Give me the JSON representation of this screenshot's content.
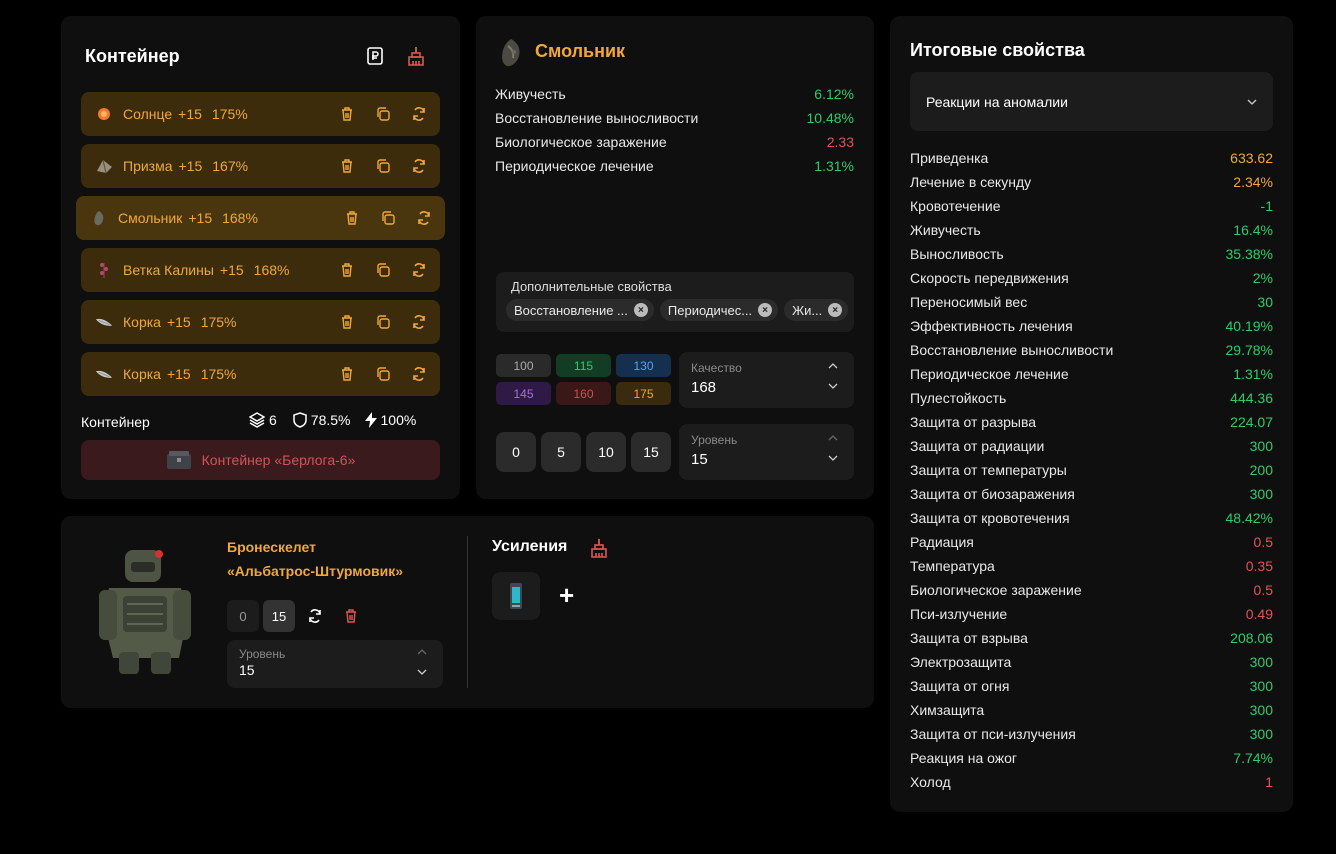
{
  "container": {
    "title": "Контейнер",
    "artifacts": [
      {
        "name": "Солнце",
        "plus": "+15",
        "percent": "175%",
        "icon": "sun-artifact-icon"
      },
      {
        "name": "Призма",
        "plus": "+15",
        "percent": "167%",
        "icon": "prism-artifact-icon"
      },
      {
        "name": "Смольник",
        "plus": "+15",
        "percent": "168%",
        "icon": "smolnik-artifact-icon"
      },
      {
        "name": "Ветка Калины",
        "plus": "+15",
        "percent": "168%",
        "icon": "kalina-branch-artifact-icon"
      },
      {
        "name": "Корка",
        "plus": "+15",
        "percent": "175%",
        "icon": "korka-artifact-icon"
      },
      {
        "name": "Корка",
        "plus": "+15",
        "percent": "175%",
        "icon": "korka-artifact-icon"
      }
    ],
    "footer_label": "Контейнер",
    "slots": "6",
    "protection": "78.5%",
    "energy": "100%",
    "container_button": "Контейнер «Берлога-6»",
    "colors": {
      "row_bg": "#3c2c0b",
      "accent": "#f0a83c",
      "container_btn_bg": "#3a1a1c",
      "container_btn_text": "#d0545a"
    }
  },
  "artifact": {
    "name": "Смольник",
    "stats": [
      {
        "label": "Живучесть",
        "value": "6.12%",
        "tone": "green"
      },
      {
        "label": "Восстановление выносливости",
        "value": "10.48%",
        "tone": "green"
      },
      {
        "label": "Биологическое заражение",
        "value": "2.33",
        "tone": "red"
      },
      {
        "label": "Периодическое лечение",
        "value": "1.31%",
        "tone": "green"
      }
    ],
    "extra_title": "Дополнительные свойства",
    "extra_chips": [
      "Восстановление ...",
      "Периодичес...",
      "Жи..."
    ],
    "quality_buttons": [
      {
        "label": "100",
        "bg": "#2a2a2a",
        "fg": "#aaaaaa"
      },
      {
        "label": "115",
        "bg": "#123d24",
        "fg": "#2fcb6a"
      },
      {
        "label": "130",
        "bg": "#15304f",
        "fg": "#5aa0f0"
      },
      {
        "label": "145",
        "bg": "#2e1a45",
        "fg": "#a870e0"
      },
      {
        "label": "160",
        "bg": "#3a1818",
        "fg": "#d05050"
      },
      {
        "label": "175",
        "bg": "#3a2a0e",
        "fg": "#f0a83c"
      }
    ],
    "quality_label": "Качество",
    "quality_value": "168",
    "level_buttons": [
      "0",
      "5",
      "10",
      "15"
    ],
    "level_label": "Уровень",
    "level_value": "15"
  },
  "armor": {
    "name_line1": "Бронескелет",
    "name_line2": "«Альбатрос-Штурмовик»",
    "level_buttons": [
      "0",
      "15"
    ],
    "level_label": "Уровень",
    "level_value": "15",
    "boosts_title": "Усиления",
    "add_symbol": "+"
  },
  "totals": {
    "title": "Итоговые свойства",
    "dropdown": "Реакции на аномалии",
    "rows": [
      {
        "label": "Приведенка",
        "value": "633.62",
        "tone": "orange"
      },
      {
        "label": "Лечение в секунду",
        "value": "2.34%",
        "tone": "orange"
      },
      {
        "label": "Кровотечение",
        "value": "-1",
        "tone": "green"
      },
      {
        "label": "Живучесть",
        "value": "16.4%",
        "tone": "green"
      },
      {
        "label": "Выносливость",
        "value": "35.38%",
        "tone": "green"
      },
      {
        "label": "Скорость передвижения",
        "value": "2%",
        "tone": "green"
      },
      {
        "label": "Переносимый вес",
        "value": "30",
        "tone": "green"
      },
      {
        "label": "Эффективность лечения",
        "value": "40.19%",
        "tone": "green"
      },
      {
        "label": "Восстановление выносливости",
        "value": "29.78%",
        "tone": "green"
      },
      {
        "label": "Периодическое лечение",
        "value": "1.31%",
        "tone": "green"
      },
      {
        "label": "Пулестойкость",
        "value": "444.36",
        "tone": "green"
      },
      {
        "label": "Защита от разрыва",
        "value": "224.07",
        "tone": "green"
      },
      {
        "label": "Защита от радиации",
        "value": "300",
        "tone": "green"
      },
      {
        "label": "Защита от температуры",
        "value": "200",
        "tone": "green"
      },
      {
        "label": "Защита от биозаражения",
        "value": "300",
        "tone": "green"
      },
      {
        "label": "Защита от кровотечения",
        "value": "48.42%",
        "tone": "green"
      },
      {
        "label": "Радиация",
        "value": "0.5",
        "tone": "red"
      },
      {
        "label": "Температура",
        "value": "0.35",
        "tone": "red"
      },
      {
        "label": "Биологическое заражение",
        "value": "0.5",
        "tone": "red"
      },
      {
        "label": "Пси-излучение",
        "value": "0.49",
        "tone": "red"
      },
      {
        "label": "Защита от взрыва",
        "value": "208.06",
        "tone": "green"
      },
      {
        "label": "Электрозащита",
        "value": "300",
        "tone": "green"
      },
      {
        "label": "Защита от огня",
        "value": "300",
        "tone": "green"
      },
      {
        "label": "Химзащита",
        "value": "300",
        "tone": "green"
      },
      {
        "label": "Защита от пси-излучения",
        "value": "300",
        "tone": "green"
      },
      {
        "label": "Реакция на ожог",
        "value": "7.74%",
        "tone": "green"
      },
      {
        "label": "Холод",
        "value": "1",
        "tone": "red"
      }
    ]
  }
}
